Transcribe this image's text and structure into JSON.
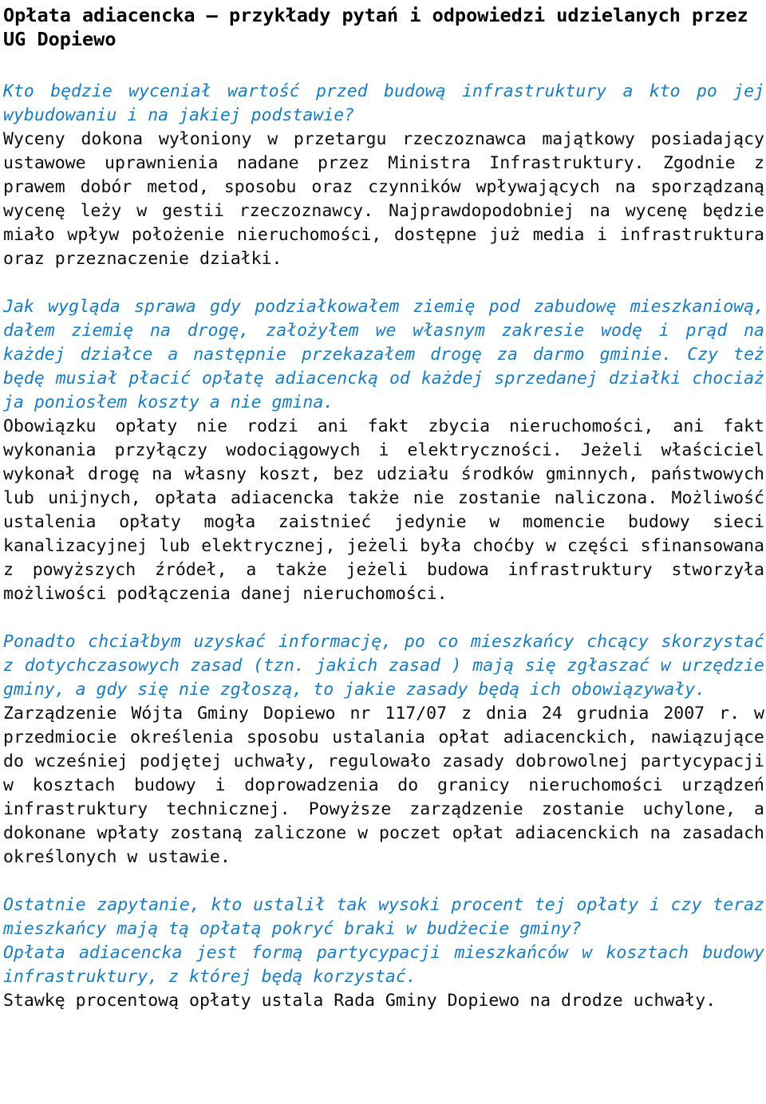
{
  "document": {
    "title": "Opłata adiacencka – przykłady pytań i odpowiedzi udzielanych przez UG Dopiewo",
    "colors": {
      "question_blue": "#1a7cc1",
      "answer_black": "#0d0d0d",
      "background": "#ffffff"
    },
    "sections": [
      {
        "id": "section-1",
        "question": "Kto będzie wyceniał wartość przed budową infrastruktury a kto po jej wybudowaniu i na jakiej podstawie?",
        "answer": "Wyceny dokona wyłoniony w przetargu rzeczoznawca majątkowy posiadający ustawowe uprawnienia nadane przez Ministra Infrastruktury. Zgodnie z prawem dobór metod, sposobu oraz czynników wpływających na sporządzaną wycenę leży w gestii rzeczoznawcy. Najprawdopodobniej na wycenę będzie miało wpływ położenie nieruchomości, dostępne już media i infrastruktura oraz przeznaczenie działki."
      },
      {
        "id": "section-2",
        "question": "Jak wygląda sprawa gdy podziałkowałem ziemię pod zabudowę mieszkaniową, dałem ziemię na drogę, założyłem we własnym zakresie wodę i prąd na każdej działce a następnie przekazałem drogę za darmo gminie. Czy też będę musiał płacić opłatę adiacencką od każdej sprzedanej działki chociaż ja poniosłem koszty a nie gmina.",
        "answer": "Obowiązku opłaty nie rodzi ani fakt zbycia nieruchomości, ani fakt wykonania przyłączy wodociągowych i elektryczności. Jeżeli właściciel wykonał drogę na własny koszt, bez udziału środków gminnych, państwowych lub unijnych, opłata adiacencka także nie zostanie naliczona. Możliwość ustalenia opłaty mogła zaistnieć jedynie w momencie budowy sieci kanalizacyjnej lub elektrycznej, jeżeli była choćby w części sfinansowana z powyższych źródeł, a także jeżeli budowa infrastruktury stworzyła możliwości podłączenia danej nieruchomości."
      },
      {
        "id": "section-3",
        "question": "Ponadto chciałbym uzyskać informację, po co mieszkańcy chcący skorzystać z dotychczasowych zasad (tzn. jakich zasad ) mają się zgłaszać w urzędzie gminy, a gdy się nie zgłoszą, to jakie zasady będą ich obowiązywały.",
        "answer": "Zarządzenie Wójta Gminy Dopiewo nr 117/07 z dnia 24 grudnia 2007 r. w przedmiocie określenia sposobu ustalania opłat adiacenckich, nawiązujące do wcześniej podjętej uchwały, regulowało zasady dobrowolnej partycypacji w kosztach budowy i doprowadzenia do granicy nieruchomości urządzeń infrastruktury technicznej. Powyższe zarządzenie zostanie uchylone, a dokonane wpłaty zostaną zaliczone w poczet opłat adiacenckich na zasadach określonych w ustawie."
      },
      {
        "id": "section-4",
        "question": "Ostatnie zapytanie, kto ustalił tak wysoki procent tej opłaty i czy teraz mieszkańcy mają tą opłatą pokryć braki w budżecie gminy?",
        "question_continued": "Opłata adiacencka jest formą partycypacji mieszkańców w kosztach budowy infrastruktury, z której będą korzystać.",
        "answer": "Stawkę procentową opłaty ustala Rada Gminy Dopiewo na drodze uchwały."
      }
    ]
  }
}
